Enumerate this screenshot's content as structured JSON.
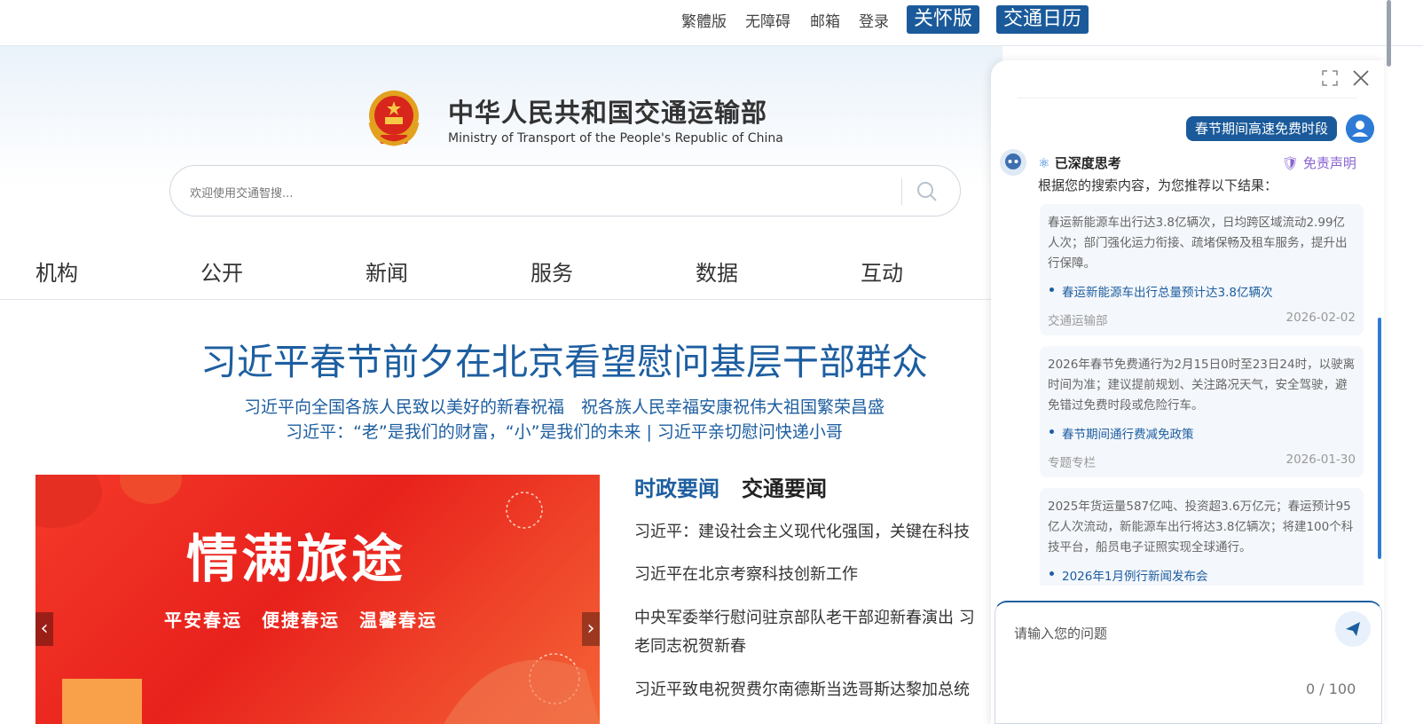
{
  "topbar": {
    "links": [
      "繁體版",
      "无障碍",
      "邮箱",
      "登录"
    ],
    "care_button": "关怀版",
    "calendar_button": "交通日历"
  },
  "header": {
    "title": "中华人民共和国交通运输部",
    "subtitle": "Ministry of Transport of the People's Republic of China",
    "search_placeholder": "欢迎使用交通智搜..."
  },
  "nav": [
    "机构",
    "公开",
    "新闻",
    "服务",
    "数据",
    "互动"
  ],
  "headline": {
    "title": "习近平春节前夕在北京看望慰问基层干部群众",
    "sub1": "习近平向全国各族人民致以美好的新春祝福　祝各族人民幸福安康祝伟大祖国繁荣昌盛",
    "sub2": "习近平：“老”是我们的财富，“小”是我们的未来 | 习近平亲切慰问快递小哥"
  },
  "banner": {
    "main_text": "情满旅途",
    "tagline": "平安春运　便捷春运　温馨春运"
  },
  "news": {
    "tabs": [
      "时政要闻",
      "交通要闻"
    ],
    "items": [
      "习近平：建设社会主义现代化强国，关键在科技",
      "习近平在北京考察科技创新工作",
      "中央军委举行慰问驻京部队老干部迎新春演出 习",
      "老同志祝贺新春",
      "习近平致电祝贺费尔南德斯当选哥斯达黎加总统"
    ]
  },
  "chat": {
    "user_question": "春节期间高速免费时段",
    "thinking_label": "已深度思考",
    "disclaimer": "免责声明",
    "intro": "根据您的搜索内容，为您推荐以下结果：",
    "cards": [
      {
        "text": "春运新能源车出行达3.8亿辆次，日均跨区域流动2.99亿人次；部门强化运力衔接、疏堵保畅及租车服务，提升出行保障。",
        "link": "春运新能源车出行总量预计达3.8亿辆次",
        "source": "交通运输部",
        "date": "2026-02-02"
      },
      {
        "text": "2026年春节免费通行为2月15日0时至23日24时，以驶离时间为准；建议提前规划、关注路况天气，安全驾驶，避免错过免费时段或危险行车。",
        "link": "春节期间通行费减免政策",
        "source": "专题专栏",
        "date": "2026-01-30"
      },
      {
        "text": "2025年货运量587亿吨、投资超3.6万亿元；春运预计95亿人次流动，新能源车出行将达3.8亿辆次；将建100个科技平台，船员电子证照实现全球通行。",
        "link": "2026年1月例行新闻发布会",
        "source": "",
        "date": ""
      }
    ],
    "input_placeholder": "请输入您的问题",
    "counter": "0 / 100"
  },
  "colors": {
    "brand_blue": "#1a5a9a",
    "headline_blue": "#1d5ea0",
    "banner_red": "#e8211c",
    "disclaimer_purple": "#8a63d2"
  }
}
